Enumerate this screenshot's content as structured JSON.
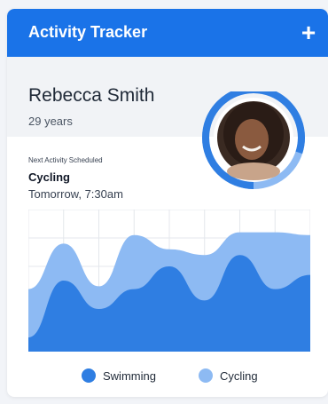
{
  "header": {
    "title": "Activity Tracker",
    "add_icon": "plus-icon",
    "add_symbol": "+"
  },
  "profile": {
    "name": "Rebecca Smith",
    "age": "29 years",
    "avatar_progress": 0.8
  },
  "schedule": {
    "label": "Next Activity Scheduled",
    "activity": "Cycling",
    "time": "Tomorrow, 7:30am"
  },
  "colors": {
    "primary": "#1a73e8",
    "swimming": "#2f7ee2",
    "cycling": "#8dbaf3",
    "ring_light": "#8dbaf3"
  },
  "chart_data": {
    "type": "area",
    "grid": true,
    "x_count": 9,
    "series": [
      {
        "name": "Swimming",
        "values": [
          0.5,
          2.5,
          1.5,
          2.2,
          3.0,
          1.8,
          3.4,
          2.2,
          2.7
        ]
      },
      {
        "name": "Cycling",
        "values": [
          2.2,
          3.8,
          2.3,
          4.1,
          3.6,
          3.4,
          4.2,
          4.2,
          4.1
        ]
      }
    ],
    "ylim": [
      0,
      5
    ]
  },
  "legend": [
    {
      "label": "Swimming",
      "color": "#2f7ee2"
    },
    {
      "label": "Cycling",
      "color": "#8dbaf3"
    }
  ]
}
